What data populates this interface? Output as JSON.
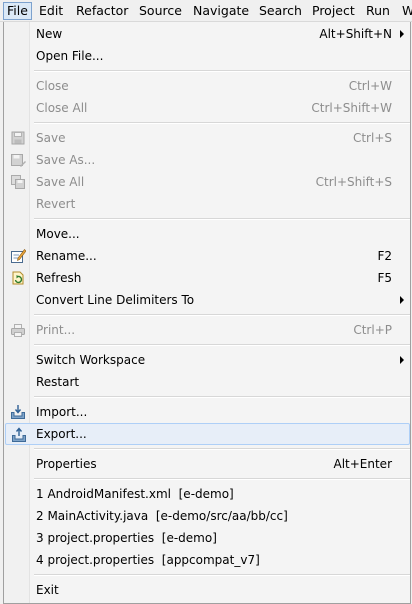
{
  "menubar": {
    "items": [
      {
        "label": "File",
        "active": true
      },
      {
        "label": "Edit"
      },
      {
        "label": "Refactor"
      },
      {
        "label": "Source"
      },
      {
        "label": "Navigate"
      },
      {
        "label": "Search"
      },
      {
        "label": "Project"
      },
      {
        "label": "Run"
      },
      {
        "label": "W"
      }
    ]
  },
  "file_menu": {
    "new": {
      "label": "New",
      "accel": "Alt+Shift+N"
    },
    "open_file": {
      "label": "Open File..."
    },
    "close": {
      "label": "Close",
      "accel": "Ctrl+W"
    },
    "close_all": {
      "label": "Close All",
      "accel": "Ctrl+Shift+W"
    },
    "save": {
      "label": "Save",
      "accel": "Ctrl+S",
      "icon": "save-icon"
    },
    "save_as": {
      "label": "Save As...",
      "icon": "save-as-icon"
    },
    "save_all": {
      "label": "Save All",
      "accel": "Ctrl+Shift+S",
      "icon": "save-all-icon"
    },
    "revert": {
      "label": "Revert"
    },
    "move": {
      "label": "Move..."
    },
    "rename": {
      "label": "Rename...",
      "accel": "F2",
      "icon": "rename-icon"
    },
    "refresh": {
      "label": "Refresh",
      "accel": "F5",
      "icon": "refresh-icon"
    },
    "convert": {
      "label": "Convert Line Delimiters To"
    },
    "print": {
      "label": "Print...",
      "accel": "Ctrl+P",
      "icon": "print-icon"
    },
    "switch_workspace": {
      "label": "Switch Workspace"
    },
    "restart": {
      "label": "Restart"
    },
    "import": {
      "label": "Import...",
      "icon": "import-icon"
    },
    "export": {
      "label": "Export...",
      "icon": "export-icon"
    },
    "properties": {
      "label": "Properties",
      "accel": "Alt+Enter"
    },
    "recent": [
      "1 AndroidManifest.xml  [e-demo]",
      "2 MainActivity.java  [e-demo/src/aa/bb/cc]",
      "3 project.properties  [e-demo]",
      "4 project.properties  [appcompat_v7]"
    ],
    "exit": {
      "label": "Exit"
    }
  }
}
